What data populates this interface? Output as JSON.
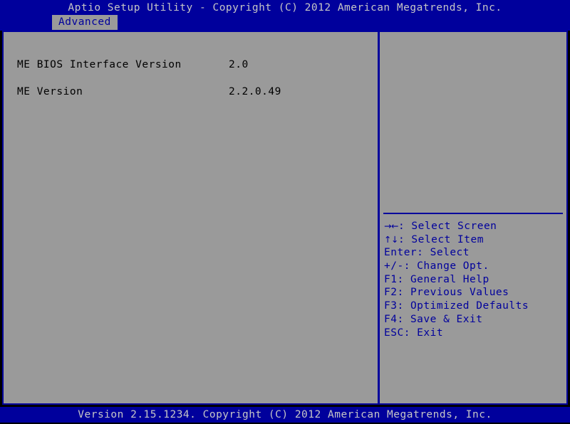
{
  "colors": {
    "blue": "#00009c",
    "gray": "#9a9a9a",
    "light_text": "#c6c6c6",
    "black_text": "#000000",
    "background": "#000000"
  },
  "titlebar": {
    "title": "Aptio Setup Utility - Copyright (C) 2012 American Megatrends, Inc."
  },
  "tabs": [
    {
      "label": "Advanced",
      "selected": true
    }
  ],
  "main": {
    "settings": [
      {
        "label": "ME BIOS Interface Version",
        "value": "2.0"
      },
      {
        "label": "ME Version",
        "value": "2.2.0.49"
      }
    ]
  },
  "help": {
    "description": "",
    "keys": [
      {
        "glyph": "→←",
        "key": "",
        "separator": ": ",
        "action": "Select Screen"
      },
      {
        "glyph": "↑↓",
        "key": "",
        "separator": ": ",
        "action": "Select Item"
      },
      {
        "glyph": "",
        "key": "Enter",
        "separator": ": ",
        "action": "Select"
      },
      {
        "glyph": "",
        "key": "+/-",
        "separator": ": ",
        "action": "Change Opt."
      },
      {
        "glyph": "",
        "key": "F1",
        "separator": ": ",
        "action": "General Help"
      },
      {
        "glyph": "",
        "key": "F2",
        "separator": ": ",
        "action": "Previous Values"
      },
      {
        "glyph": "",
        "key": "F3",
        "separator": ": ",
        "action": "Optimized Defaults"
      },
      {
        "glyph": "",
        "key": "F4",
        "separator": ": ",
        "action": "Save & Exit"
      },
      {
        "glyph": "",
        "key": "ESC",
        "separator": ": ",
        "action": "Exit"
      }
    ]
  },
  "footer": {
    "text": "Version 2.15.1234. Copyright (C) 2012 American Megatrends, Inc."
  }
}
